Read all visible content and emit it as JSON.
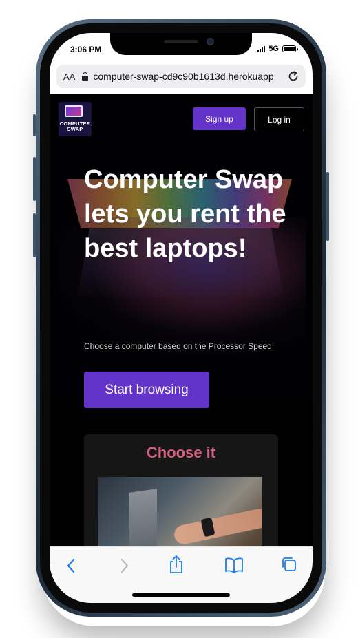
{
  "status_bar": {
    "time": "3:06 PM",
    "network": "5G",
    "icons": [
      "signal-icon",
      "battery-icon"
    ]
  },
  "browser": {
    "text_size_label": "AA",
    "url": "computer-swap-cd9c90b1613d.herokuapp.com",
    "icons": [
      "lock-icon",
      "reload-icon"
    ]
  },
  "header": {
    "logo_line1": "COMPUTER",
    "logo_line2": "SWAP",
    "signup_label": "Sign up",
    "login_label": "Log in"
  },
  "hero": {
    "headline": "Computer Swap lets you rent the best laptops!",
    "subhead": "Choose a computer based on the Processor Speed",
    "cta_label": "Start browsing"
  },
  "card": {
    "title": "Choose it"
  },
  "toolbar": {
    "icons": [
      "back-icon",
      "forward-icon",
      "share-icon",
      "bookmarks-icon",
      "tabs-icon"
    ]
  },
  "colors": {
    "accent": "#6433c9",
    "card_title": "#d65f7f",
    "ios_blue": "#1a7cf0"
  }
}
